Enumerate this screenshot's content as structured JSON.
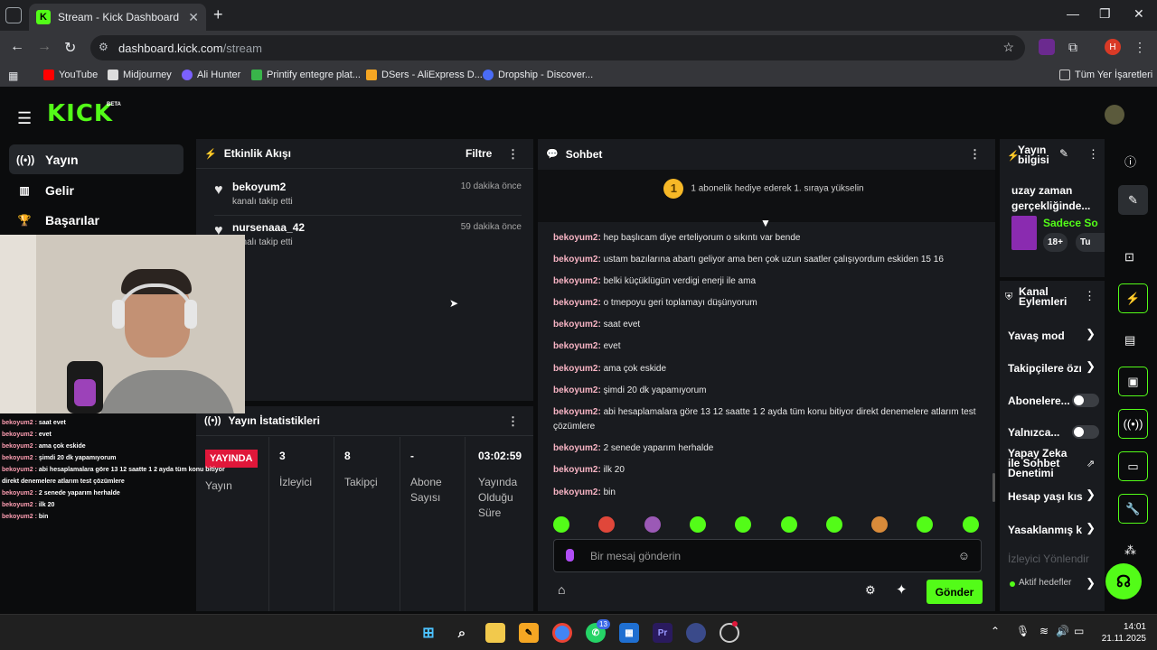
{
  "browser": {
    "tab_title": "Stream - Kick Dashboard",
    "url_host": "dashboard.kick.com",
    "url_path": "/stream",
    "profile_initial": "H",
    "bookmarks": [
      "YouTube",
      "Midjourney",
      "Ali Hunter",
      "Printify entegre plat...",
      "DSers - AliExpress D...",
      "Dropship - Discover..."
    ],
    "all_bookmarks": "Tüm Yer İşaretleri"
  },
  "brand": {
    "logo": "KICK",
    "badge": "BETA"
  },
  "nav": {
    "items": [
      {
        "label": "Yayın",
        "icon": "broadcast-icon"
      },
      {
        "label": "Gelir",
        "icon": "chart-icon"
      },
      {
        "label": "Başarılar",
        "icon": "trophy-icon"
      }
    ]
  },
  "activity": {
    "title": "Etkinlik Akışı",
    "filter": "Filtre",
    "items": [
      {
        "user": "bekoyum2",
        "desc": "kanalı takip etti",
        "time": "10 dakika önce"
      },
      {
        "user": "nursenaaa_42",
        "desc": "kanalı takip etti",
        "time": "59 dakika önce"
      }
    ]
  },
  "stats": {
    "title": "Yayın İstatistikleri",
    "live_badge": "YAYINDA",
    "cols": [
      {
        "value": "",
        "label": "Yayın"
      },
      {
        "value": "3",
        "label": "İzleyici"
      },
      {
        "value": "8",
        "label": "Takipçi"
      },
      {
        "value": "-",
        "label": "Abone Sayısı"
      },
      {
        "value": "03:02:59",
        "label": "Yayında Olduğu Süre"
      }
    ]
  },
  "chat": {
    "title": "Sohbet",
    "banner_rank": "1",
    "banner": "1 abonelik hediye ederek 1. sıraya yükselin",
    "messages": [
      {
        "user": "bekoyum2:",
        "text": "hep başlıcam diye erteliyorum o sıkıntı var bende"
      },
      {
        "user": "bekoyum2:",
        "text": "ustam bazılarına abartı geliyor ama ben çok uzun saatler çalışıyordum eskiden 15 16"
      },
      {
        "user": "bekoyum2:",
        "text": "belki küçüklügün verdigi enerji ile ama"
      },
      {
        "user": "bekoyum2:",
        "text": "o tmepoyu geri toplamayı düşünyorum"
      },
      {
        "user": "bekoyum2:",
        "text": "saat evet"
      },
      {
        "user": "bekoyum2:",
        "text": "evet"
      },
      {
        "user": "bekoyum2:",
        "text": "ama çok eskide"
      },
      {
        "user": "bekoyum2:",
        "text": "şimdi 20 dk yapamıyorum"
      },
      {
        "user": "bekoyum2:",
        "text": "abi hesaplamalara göre 13 12 saatte 1 2 ayda tüm konu bitiyor direkt denemelere atlarım test çözümlere"
      },
      {
        "user": "bekoyum2:",
        "text": "2 senede yaparım herhalde"
      },
      {
        "user": "bekoyum2:",
        "text": "ilk 20"
      },
      {
        "user": "bekoyum2:",
        "text": "bin"
      }
    ],
    "placeholder": "Bir mesaj gönderin",
    "send": "Gönder"
  },
  "stream_info": {
    "title": "Yayın bilgisi",
    "stream_title": "uzay zaman gerçekliğinde...",
    "category": "Sadece So",
    "tags": [
      "18+",
      "Tu"
    ]
  },
  "channel_actions": {
    "title": "Kanal Eylemleri",
    "items": [
      {
        "label": "Yavaş mod",
        "control": "chevron"
      },
      {
        "label": "Takipçilere özı",
        "control": "chevron"
      },
      {
        "label": "Abonelere...",
        "control": "toggle"
      },
      {
        "label": "Yalnızca...",
        "control": "toggle"
      },
      {
        "label": "Yapay Zeka ile Sohbet Denetimi",
        "control": "external"
      },
      {
        "label": "Hesap yaşı kıs",
        "control": "chevron"
      },
      {
        "label": "Yasaklanmış k",
        "control": "chevron"
      },
      {
        "label": "İzleyici Yönlendir",
        "control": "none"
      }
    ],
    "active_goals": "Aktif hedefler"
  },
  "overlay_chat": [
    {
      "user": "bekoyum2 :",
      "text": "saat evet"
    },
    {
      "user": "bekoyum2 :",
      "text": "evet"
    },
    {
      "user": "bekoyum2 :",
      "text": "ama çok eskide"
    },
    {
      "user": "bekoyum2 :",
      "text": "şimdi 20 dk yapamıyorum"
    },
    {
      "user": "bekoyum2 :",
      "text": "abi hesaplamalara göre 13 12 saatte 1 2 ayda tüm konu bitiyor direkt denemelere atlarım test çözümlere"
    },
    {
      "user": "bekoyum2 :",
      "text": "2 senede yaparım herhalde"
    },
    {
      "user": "bekoyum2 :",
      "text": "ilk 20"
    },
    {
      "user": "bekoyum2 :",
      "text": "bin"
    }
  ],
  "taskbar": {
    "time": "14:01",
    "date": "21.11.2025",
    "whatsapp_badge": "13"
  },
  "colors": {
    "kick_green": "#53fc18",
    "live_red": "#e0173a",
    "panel": "#191b1f"
  }
}
